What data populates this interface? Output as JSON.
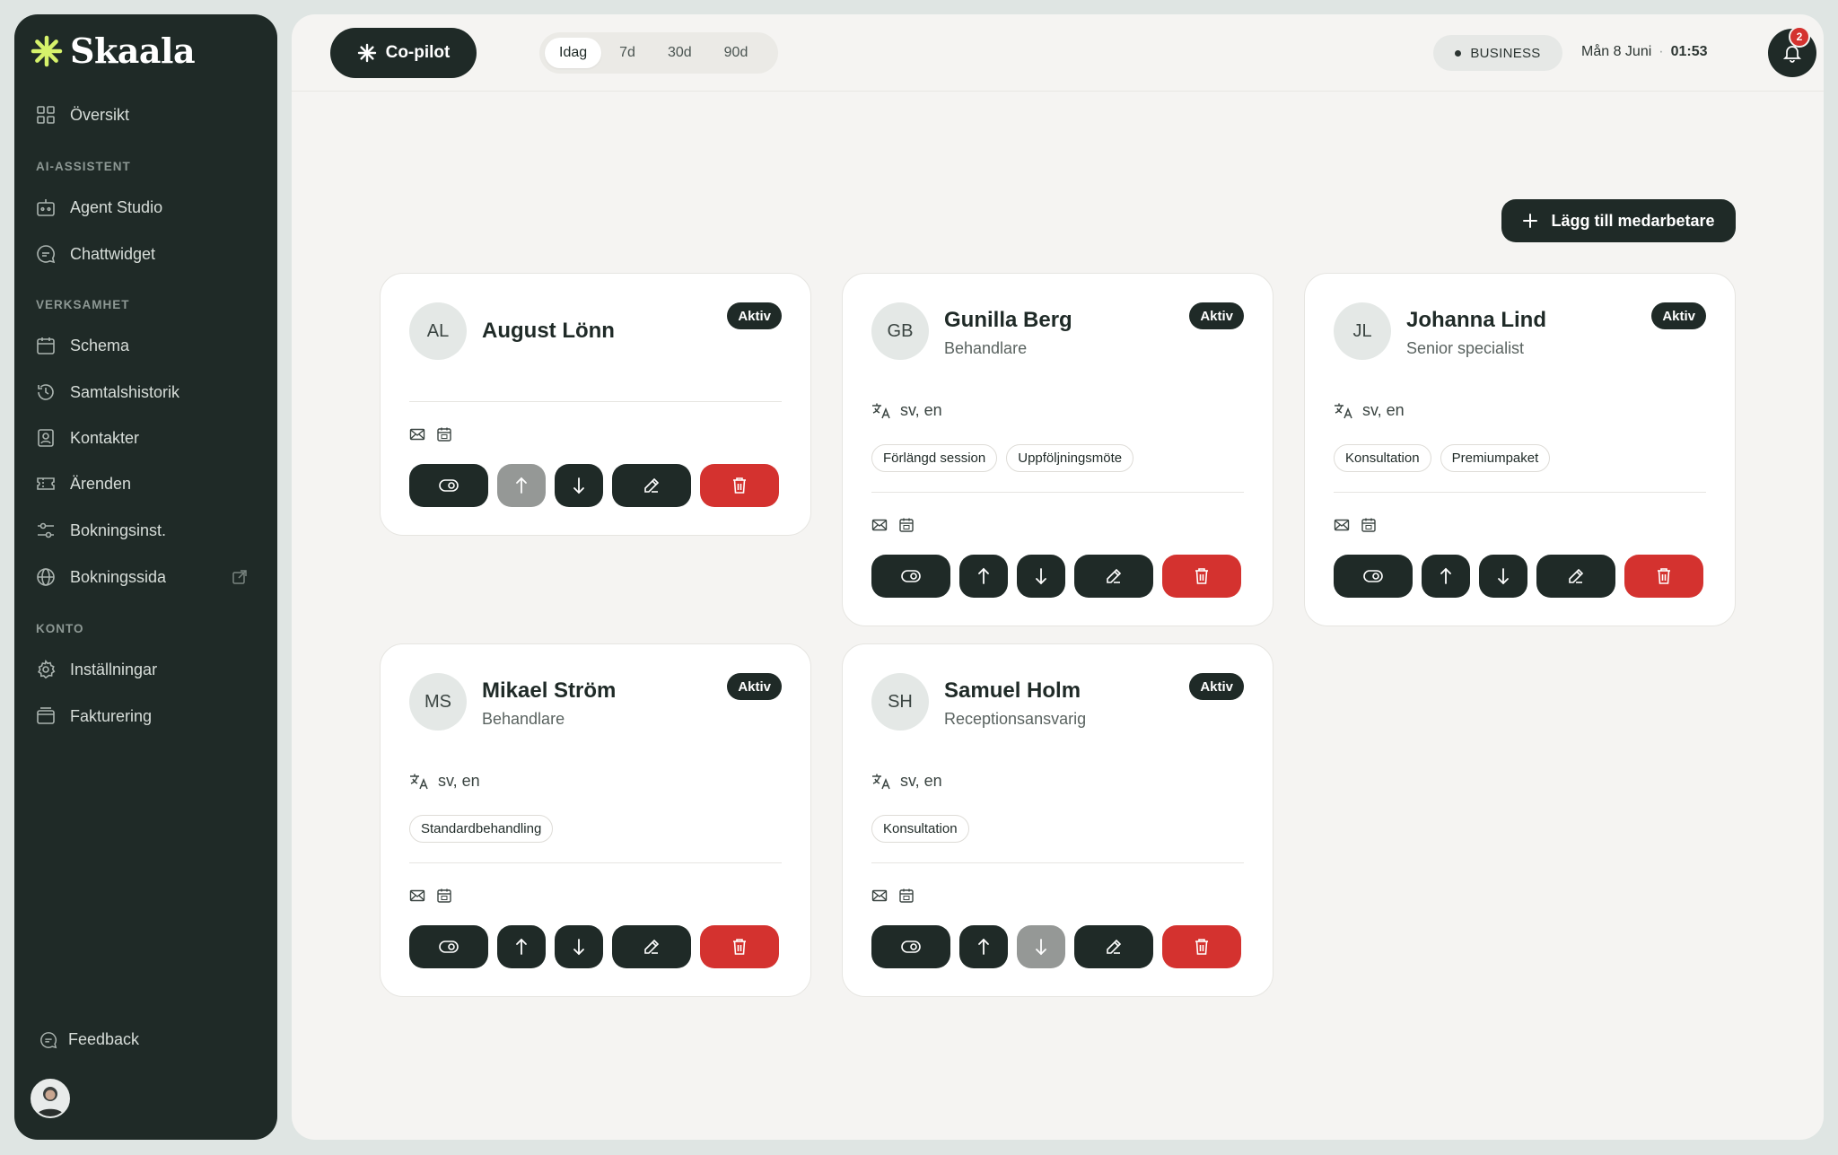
{
  "brand": {
    "name": "Skaala"
  },
  "sidebar": {
    "overview": "Översikt",
    "sections": {
      "ai": "AI-ASSISTENT",
      "business": "VERKSAMHET",
      "account": "KONTO"
    },
    "items": {
      "agent_studio": "Agent Studio",
      "chat_widget": "Chattwidget",
      "schedule": "Schema",
      "call_history": "Samtalshistorik",
      "contacts": "Kontakter",
      "cases": "Ärenden",
      "booking_settings": "Bokningsinst.",
      "booking_page": "Bokningssida",
      "settings": "Inställningar",
      "billing": "Fakturering"
    },
    "feedback": "Feedback"
  },
  "topbar": {
    "copilot": "Co-pilot",
    "ranges": [
      "Idag",
      "7d",
      "30d",
      "90d"
    ],
    "active_range": "Idag",
    "plan": "BUSINESS",
    "date": "Mån 8 Juni",
    "separator": "·",
    "time": "01:53",
    "notifications": "2"
  },
  "add_button": "Lägg till medarbetare",
  "staff": [
    {
      "initials": "AL",
      "name": "August Lönn",
      "role": "",
      "status": "Aktiv",
      "languages": "",
      "tags": []
    },
    {
      "initials": "GB",
      "name": "Gunilla Berg",
      "role": "Behandlare",
      "status": "Aktiv",
      "languages": "sv, en",
      "tags": [
        "Förlängd session",
        "Uppföljningsmöte"
      ]
    },
    {
      "initials": "JL",
      "name": "Johanna Lind",
      "role": "Senior specialist",
      "status": "Aktiv",
      "languages": "sv, en",
      "tags": [
        "Konsultation",
        "Premiumpaket"
      ]
    },
    {
      "initials": "MS",
      "name": "Mikael Ström",
      "role": "Behandlare",
      "status": "Aktiv",
      "languages": "sv, en",
      "tags": [
        "Standardbehandling"
      ]
    },
    {
      "initials": "SH",
      "name": "Samuel Holm",
      "role": "Receptionsansvarig",
      "status": "Aktiv",
      "languages": "sv, en",
      "tags": [
        "Konsultation"
      ]
    }
  ],
  "colors": {
    "sidebar_bg": "#1f2a27",
    "accent_brand": "#d6f26b",
    "danger": "#d4322f",
    "disabled": "#959896"
  }
}
